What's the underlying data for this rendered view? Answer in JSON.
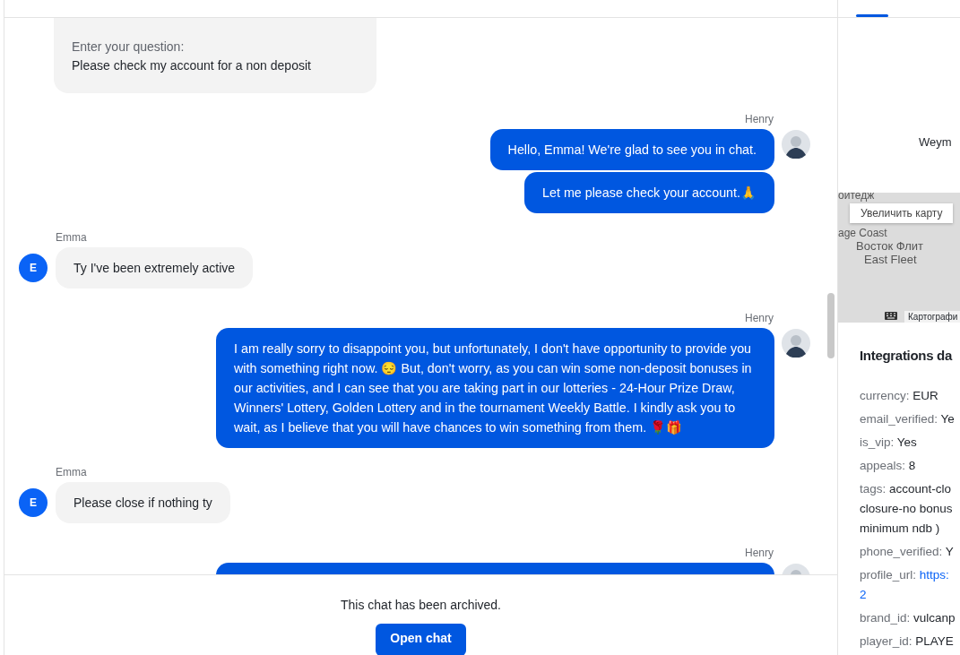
{
  "chat": {
    "items": [
      {
        "kind": "form",
        "label": "Enter your question:",
        "value": "Please check my account for a non deposit"
      },
      {
        "kind": "agent",
        "name": "Henry",
        "messages": [
          "Hello, Emma! We're glad to see you in chat.",
          "Let me please check your account.🙏"
        ]
      },
      {
        "kind": "user",
        "name": "Emma",
        "initial": "E",
        "messages": [
          "Ty I've been extremely active"
        ]
      },
      {
        "kind": "agent",
        "name": "Henry",
        "messages": [
          "I am really sorry to disappoint you, but unfortunately, I don't have opportunity to provide you with something right now. 😔 But, don't worry, as you can win some non-deposit bonuses in our activities, and I can see that you are taking part in our lotteries - 24-Hour Prize Draw, Winners' Lottery, Golden Lottery and in the tournament Weekly Battle. I kindly ask you to wait, as I believe that you will have chances to win something from them. 🌹🎁"
        ]
      },
      {
        "kind": "user",
        "name": "Emma",
        "initial": "E",
        "messages": [
          "Please close if nothing ty"
        ]
      },
      {
        "kind": "agent_cut",
        "name": "Henry"
      }
    ]
  },
  "footer": {
    "notice": "This chat has been archived.",
    "button": "Open chat"
  },
  "map": {
    "top_label": "Weym",
    "labels": [
      "оитедж",
      "age Coast"
    ],
    "zoom_hint": "Увеличить карту",
    "place_ru": "Восток Флит",
    "place_en": "East Fleet",
    "attribution": "Картографи"
  },
  "integrations": {
    "title": "Integrations da",
    "fields": [
      {
        "key": "currency:",
        "lines": [
          "EUR"
        ],
        "link": false
      },
      {
        "key": "email_verified:",
        "lines": [
          "Ye"
        ],
        "link": false
      },
      {
        "key": "is_vip:",
        "lines": [
          "Yes"
        ],
        "link": false
      },
      {
        "key": "appeals:",
        "lines": [
          "8"
        ],
        "link": false
      },
      {
        "key": "tags:",
        "lines": [
          "account-clo",
          "closure-no bonus",
          "minimum ndb )"
        ],
        "link": false
      },
      {
        "key": "phone_verified:",
        "lines": [
          "Y"
        ],
        "link": false
      },
      {
        "key": "profile_url:",
        "lines": [
          "https:",
          "2"
        ],
        "link": true
      },
      {
        "key": "brand_id:",
        "lines": [
          "vulcanp"
        ],
        "link": false
      },
      {
        "key": "player_id:",
        "lines": [
          "PLAYE"
        ],
        "link": false
      }
    ]
  }
}
